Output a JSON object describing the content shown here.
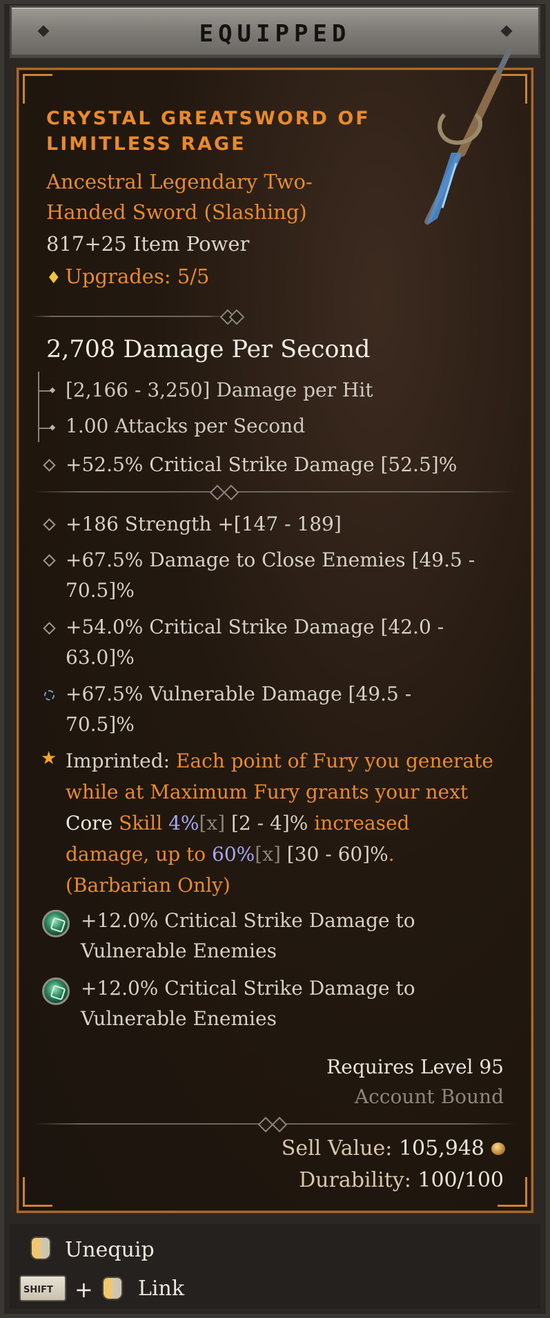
{
  "header": {
    "title": "EQUIPPED"
  },
  "item": {
    "name": "CRYSTAL GREATSWORD OF LIMITLESS RAGE",
    "type": "Ancestral Legendary Two-Handed Sword (Slashing)",
    "item_power": "817+25 Item Power",
    "upgrades": "Upgrades: 5/5",
    "icon": "greatsword-icon"
  },
  "base_stats": {
    "dps": "2,708 Damage Per Second",
    "damage_per_hit": "[2,166 - 3,250] Damage per Hit",
    "attacks_per_second": "1.00 Attacks per Second",
    "implicit": "+52.5% Critical Strike Damage [52.5]%"
  },
  "affixes": [
    {
      "text": "+186 Strength +[147 - 189]"
    },
    {
      "text": "+67.5% Damage to Close Enemies [49.5 - 70.5]%"
    },
    {
      "text": "+54.0% Critical Strike Damage [42.0 - 63.0]%"
    },
    {
      "text": "+67.5% Vulnerable Damage [49.5 - 70.5]%"
    }
  ],
  "imprint": {
    "label": "Imprinted:",
    "p1": " Each point of Fury you generate while at Maximum Fury grants your next ",
    "core": "Core",
    "skill": " Skill ",
    "val1": "4%",
    "x1": "[x]",
    "range1": " [2 - 4]%",
    "p2": " increased damage, up to ",
    "val2": "60%",
    "x2": "[x]",
    "range2": " [30 - 60]%",
    "p3": ". (Barbarian Only)"
  },
  "sockets": [
    {
      "text": "+12.0% Critical Strike Damage to Vulnerable Enemies"
    },
    {
      "text": "+12.0% Critical Strike Damage to Vulnerable Enemies"
    }
  ],
  "requirements": {
    "level": "Requires Level 95",
    "bound": "Account Bound"
  },
  "value": {
    "sell_label": "Sell Value:",
    "sell_value": "105,948",
    "durability_label": "Durability:",
    "durability_value": "100/100"
  },
  "footer": {
    "unequip": "Unequip",
    "shift": "SHIFT",
    "plus": "+",
    "link": "Link"
  },
  "colors": {
    "legendary": "#e88a2f",
    "magic_value": "#a8a7f3",
    "border": "#a86a2c"
  }
}
